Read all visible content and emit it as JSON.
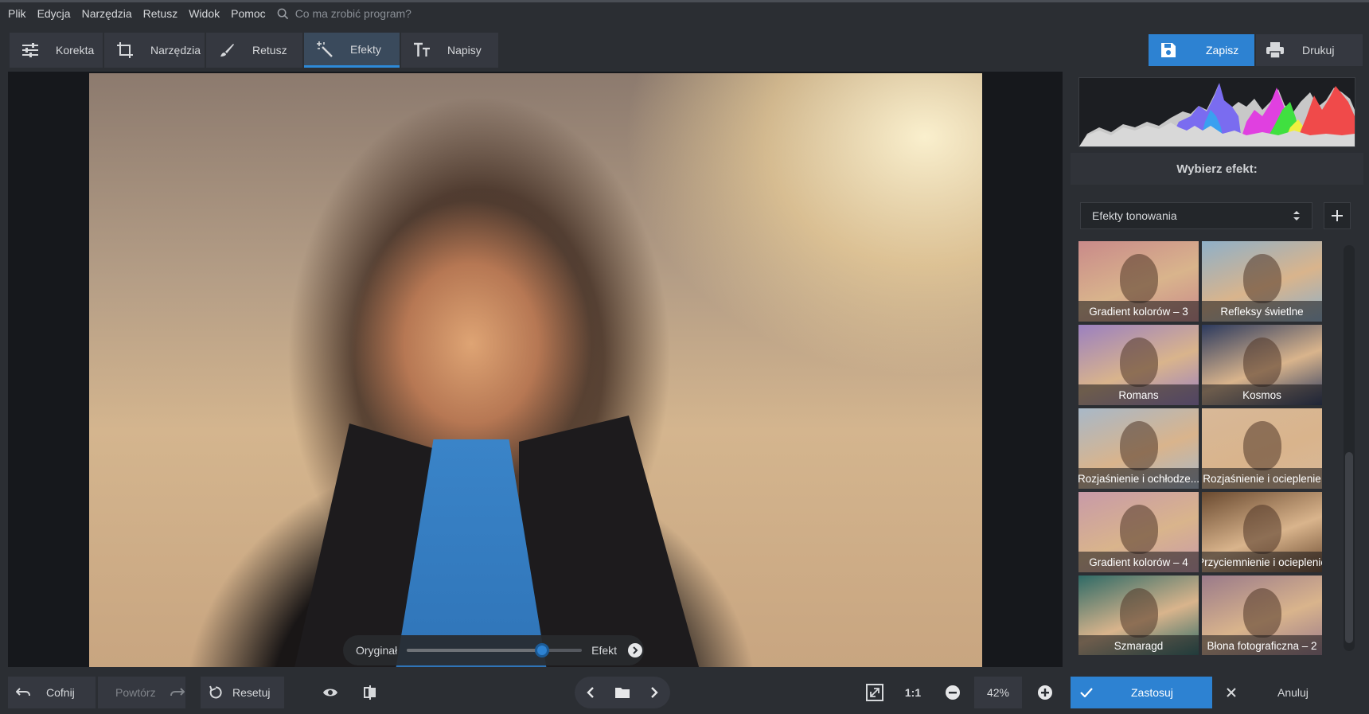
{
  "menu": {
    "items": [
      "Plik",
      "Edycja",
      "Narzędzia",
      "Retusz",
      "Widok",
      "Pomoc"
    ],
    "search_placeholder": "Co ma zrobić program?"
  },
  "toolbar": {
    "tabs": [
      {
        "label": "Korekta",
        "icon": "sliders-icon",
        "active": false
      },
      {
        "label": "Narzędzia",
        "icon": "crop-icon",
        "active": false
      },
      {
        "label": "Retusz",
        "icon": "brush-icon",
        "active": false
      },
      {
        "label": "Efekty",
        "icon": "magic-wand-icon",
        "active": true
      },
      {
        "label": "Napisy",
        "icon": "text-icon",
        "active": false
      }
    ],
    "save_label": "Zapisz",
    "print_label": "Drukuj"
  },
  "compare": {
    "left_label": "Oryginał",
    "right_label": "Efekt",
    "value": 0.77
  },
  "panel": {
    "title": "Wybierz efekt:",
    "category": "Efekty tonowania",
    "effects": [
      {
        "name": "Gradient kolorów – 3",
        "tint": "#c98a8a"
      },
      {
        "name": "Refleksy świetlne",
        "tint": "#8fb0c8"
      },
      {
        "name": "Romans",
        "tint": "#9b80c0"
      },
      {
        "name": "Kosmos",
        "tint": "#2c3a5e"
      },
      {
        "name": "Rozjaśnienie i ochłodze...",
        "tint": "#a8b8c8"
      },
      {
        "name": "Rozjaśnienie i ocieplenie",
        "tint": "#d8b898"
      },
      {
        "name": "Gradient kolorów – 4",
        "tint": "#c89aa8"
      },
      {
        "name": "Przyciemnienie i ocieplenie",
        "tint": "#6a4a30"
      },
      {
        "name": "Szmaragd",
        "tint": "#2e6a66"
      },
      {
        "name": "Błona fotograficzna – 2",
        "tint": "#9a7a8a"
      }
    ]
  },
  "bottom": {
    "undo_label": "Cofnij",
    "redo_label": "Powtórz",
    "reset_label": "Resetuj",
    "ratio_label": "1:1",
    "zoom_value": "42%",
    "apply_label": "Zastosuj",
    "cancel_label": "Anuluj"
  },
  "colors": {
    "accent": "#2d82d2",
    "background": "#2b2e33",
    "canvas": "#16181c"
  }
}
